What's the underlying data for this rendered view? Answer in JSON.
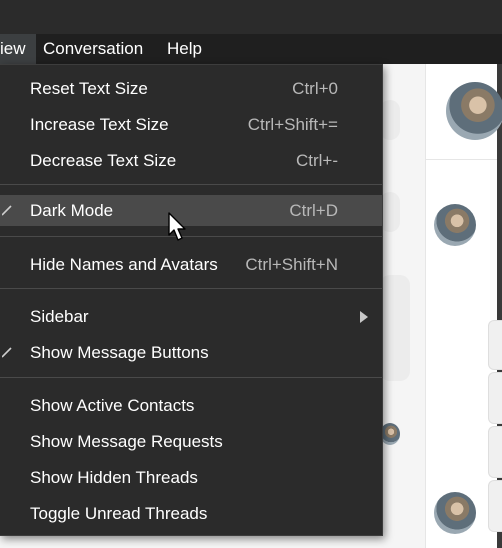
{
  "menubar": {
    "view_label": "iew",
    "conversation_label": "Conversation",
    "help_label": "Help"
  },
  "view_menu": {
    "items": [
      {
        "label": "Reset Text Size",
        "shortcut": "Ctrl+0"
      },
      {
        "label": "Increase Text Size",
        "shortcut": "Ctrl+Shift+="
      },
      {
        "label": "Decrease Text Size",
        "shortcut": "Ctrl+-"
      },
      {
        "label": "Dark Mode",
        "shortcut": "Ctrl+D",
        "checked": true
      },
      {
        "label": "Hide Names and Avatars",
        "shortcut": "Ctrl+Shift+N"
      },
      {
        "label": "Sidebar",
        "submenu": true
      },
      {
        "label": "Show Message Buttons",
        "checked": true
      },
      {
        "label": "Show Active Contacts"
      },
      {
        "label": "Show Message Requests"
      },
      {
        "label": "Show Hidden Threads"
      },
      {
        "label": "Toggle Unread Threads"
      }
    ]
  },
  "icons": {
    "check": "checkmark-icon",
    "submenu": "chevron-right-icon",
    "pointer": "mouse-cursor-icon"
  },
  "colors": {
    "menu_bg": "#2b2b2b",
    "menu_hover": "#4a4a4a",
    "menubar_bg": "#1f1f1f",
    "text": "#ffffff",
    "shortcut_text": "#b8b8b8"
  }
}
